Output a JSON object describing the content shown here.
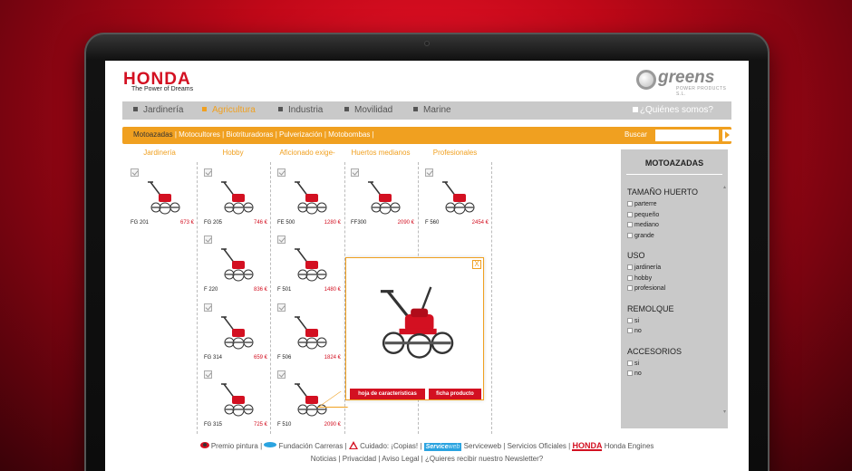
{
  "header": {
    "brand": "HONDA",
    "tagline": "The Power of Dreams",
    "partner": "greens",
    "partner_sub": "POWER PRODUCTS S.L."
  },
  "nav": {
    "items": [
      "Jardinería",
      "Agricultura",
      "Industria",
      "Movilidad",
      "Marine"
    ],
    "active": "Agricultura",
    "about": "¿Quiénes somos?"
  },
  "subnav": {
    "items": [
      "Motoazadas",
      "Motocultores",
      "Biotrituradoras",
      "Pulverización",
      "Motobombas"
    ],
    "current": "Motoazadas",
    "search_label": "Buscar",
    "search_value": ""
  },
  "columns": [
    "Jardinería",
    "Hobby",
    "Aficionado exige-",
    "Huertos medianos",
    "Profesionales"
  ],
  "products": [
    {
      "name": "FG 201",
      "price": "673 €"
    },
    {
      "name": "FG 205",
      "price": "746 €"
    },
    {
      "name": "FE 500",
      "price": "1280 €"
    },
    {
      "name": "FF300",
      "price": "2090 €"
    },
    {
      "name": "F 560",
      "price": "2454 €"
    },
    {
      "name": "F 220",
      "price": "836 €"
    },
    {
      "name": "F 501",
      "price": "1480 €"
    },
    {
      "name": "FG 314",
      "price": "659 €"
    },
    {
      "name": "F 506",
      "price": "1824 €"
    },
    {
      "name": "FG 315",
      "price": "725 €"
    },
    {
      "name": "F 510",
      "price": "2090 €"
    }
  ],
  "popup": {
    "close": "X",
    "btn_specs": "hoja de características",
    "btn_sheet": "ficha producto"
  },
  "filters": {
    "title": "MOTOAZADAS",
    "sections": [
      {
        "label": "TAMAÑO HUERTO",
        "options": [
          "parterre",
          "pequeño",
          "mediano",
          "grande"
        ]
      },
      {
        "label": "USO",
        "options": [
          "jardinería",
          "hobby",
          "profesional"
        ]
      },
      {
        "label": "REMOLQUE",
        "options": [
          "si",
          "no"
        ]
      },
      {
        "label": "ACCESORIOS",
        "options": [
          "si",
          "no"
        ]
      }
    ]
  },
  "footer": {
    "links1": [
      "Premio pintura",
      "Fundación Carreras",
      "Cuidado: ¡Copias!",
      "Serviceweb",
      "Servicios Oficiales",
      "Honda Engines"
    ],
    "service_badge": "Service",
    "service_badge_sub": "web",
    "honda_badge": "HONDA",
    "links2": [
      "Noticias",
      "Privacidad",
      "Aviso Legal",
      "¿Quieres recibir nuestro Newsletter?"
    ]
  },
  "colors": {
    "accent": "#f0a020",
    "brand_red": "#d31021",
    "nav_gray": "#c9c9c9"
  }
}
